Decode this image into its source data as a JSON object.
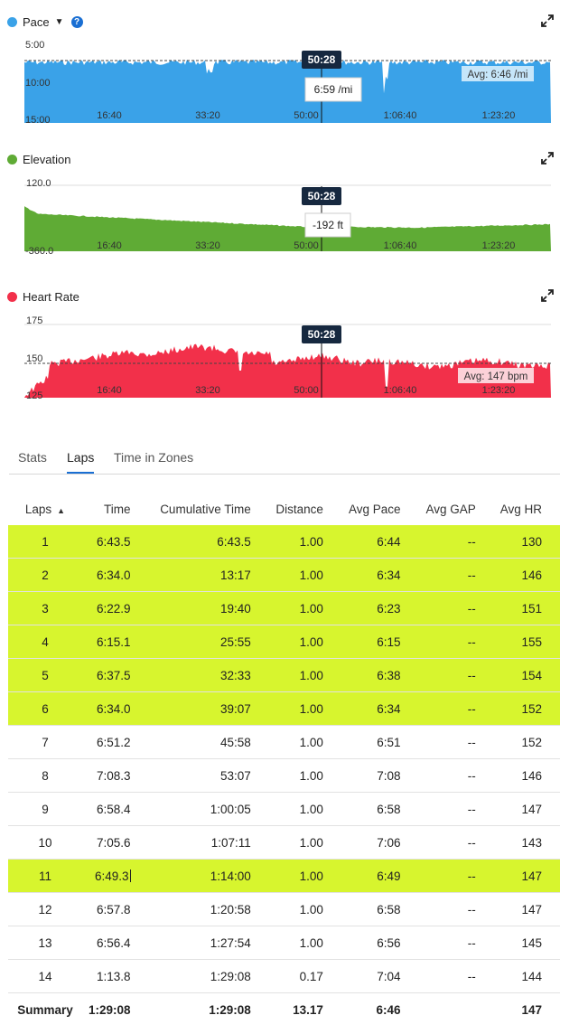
{
  "charts": [
    {
      "id": "pace",
      "title": "Pace",
      "color": "#3aa2e8",
      "y_ticks": [
        "5:00",
        "10:00",
        "15:00"
      ],
      "x_ticks": [
        "16:40",
        "33:20",
        "50:00",
        "1:06:40",
        "1:23:20"
      ],
      "cursor_label": "50:28",
      "tooltip": "6:59 /mi",
      "avg_label": "Avg: 6:46 /mi"
    },
    {
      "id": "elevation",
      "title": "Elevation",
      "color": "#5fab35",
      "y_ticks": [
        "120.0",
        "-360.0"
      ],
      "x_ticks": [
        "16:40",
        "33:20",
        "50:00",
        "1:06:40",
        "1:23:20"
      ],
      "cursor_label": "50:28",
      "tooltip": "-192 ft"
    },
    {
      "id": "heart-rate",
      "title": "Heart Rate",
      "color": "#f2304a",
      "y_ticks": [
        "175",
        "150",
        "125"
      ],
      "x_ticks": [
        "16:40",
        "33:20",
        "50:00",
        "1:06:40",
        "1:23:20"
      ],
      "cursor_label": "50:28",
      "avg_label": "Avg: 147 bpm"
    }
  ],
  "tabs": [
    {
      "label": "Stats",
      "active": false
    },
    {
      "label": "Laps",
      "active": true
    },
    {
      "label": "Time in Zones",
      "active": false
    }
  ],
  "table": {
    "columns": [
      "Laps",
      "Time",
      "Cumulative Time",
      "Distance",
      "Avg Pace",
      "Avg GAP",
      "Avg HR"
    ],
    "sort_indicator": "▲",
    "rows": [
      {
        "lap": "1",
        "time": "6:43.5",
        "cum": "6:43.5",
        "dist": "1.00",
        "pace": "6:44",
        "gap": "--",
        "hr": "130",
        "highlight": true
      },
      {
        "lap": "2",
        "time": "6:34.0",
        "cum": "13:17",
        "dist": "1.00",
        "pace": "6:34",
        "gap": "--",
        "hr": "146",
        "highlight": true
      },
      {
        "lap": "3",
        "time": "6:22.9",
        "cum": "19:40",
        "dist": "1.00",
        "pace": "6:23",
        "gap": "--",
        "hr": "151",
        "highlight": true
      },
      {
        "lap": "4",
        "time": "6:15.1",
        "cum": "25:55",
        "dist": "1.00",
        "pace": "6:15",
        "gap": "--",
        "hr": "155",
        "highlight": true
      },
      {
        "lap": "5",
        "time": "6:37.5",
        "cum": "32:33",
        "dist": "1.00",
        "pace": "6:38",
        "gap": "--",
        "hr": "154",
        "highlight": true
      },
      {
        "lap": "6",
        "time": "6:34.0",
        "cum": "39:07",
        "dist": "1.00",
        "pace": "6:34",
        "gap": "--",
        "hr": "152",
        "highlight": true
      },
      {
        "lap": "7",
        "time": "6:51.2",
        "cum": "45:58",
        "dist": "1.00",
        "pace": "6:51",
        "gap": "--",
        "hr": "152",
        "highlight": false
      },
      {
        "lap": "8",
        "time": "7:08.3",
        "cum": "53:07",
        "dist": "1.00",
        "pace": "7:08",
        "gap": "--",
        "hr": "146",
        "highlight": false
      },
      {
        "lap": "9",
        "time": "6:58.4",
        "cum": "1:00:05",
        "dist": "1.00",
        "pace": "6:58",
        "gap": "--",
        "hr": "147",
        "highlight": false
      },
      {
        "lap": "10",
        "time": "7:05.6",
        "cum": "1:07:11",
        "dist": "1.00",
        "pace": "7:06",
        "gap": "--",
        "hr": "143",
        "highlight": false
      },
      {
        "lap": "11",
        "time": "6:49.3",
        "cum": "1:14:00",
        "dist": "1.00",
        "pace": "6:49",
        "gap": "--",
        "hr": "147",
        "highlight": true
      },
      {
        "lap": "12",
        "time": "6:57.8",
        "cum": "1:20:58",
        "dist": "1.00",
        "pace": "6:58",
        "gap": "--",
        "hr": "147",
        "highlight": false
      },
      {
        "lap": "13",
        "time": "6:56.4",
        "cum": "1:27:54",
        "dist": "1.00",
        "pace": "6:56",
        "gap": "--",
        "hr": "145",
        "highlight": false
      },
      {
        "lap": "14",
        "time": "1:13.8",
        "cum": "1:29:08",
        "dist": "0.17",
        "pace": "7:04",
        "gap": "--",
        "hr": "144",
        "highlight": false
      }
    ],
    "summary": {
      "lap": "Summary",
      "time": "1:29:08",
      "cum": "1:29:08",
      "dist": "13.17",
      "pace": "6:46",
      "gap": "",
      "hr": "147"
    }
  }
}
